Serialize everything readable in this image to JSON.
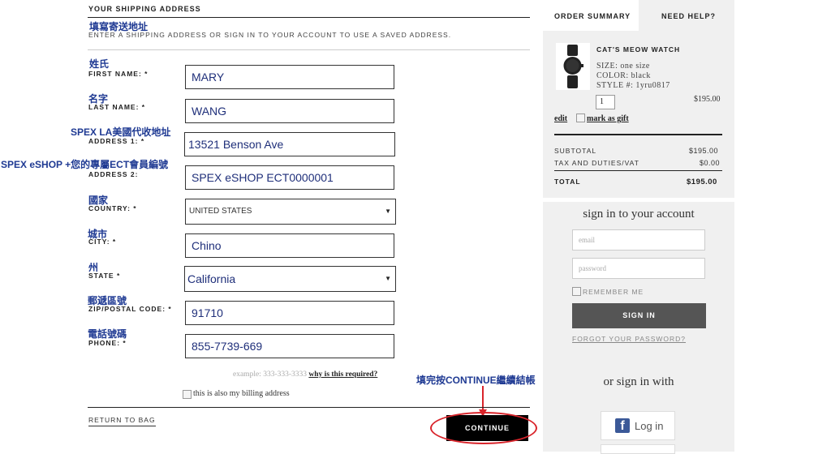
{
  "shipping": {
    "title": "YOUR SHIPPING ADDRESS",
    "title_cn": "填寫寄送地址",
    "instruction": "ENTER A SHIPPING ADDRESS OR SIGN IN TO YOUR ACCOUNT TO USE A SAVED ADDRESS.",
    "fields": {
      "first_name": {
        "label_cn": "姓氏",
        "label": "FIRST NAME: *",
        "value": "MARY"
      },
      "last_name": {
        "label_cn": "名字",
        "label": "LAST NAME: *",
        "value": "WANG"
      },
      "address1": {
        "label_cn": "SPEX LA美國代收地址",
        "label": "ADDRESS 1: *",
        "value": "13521 Benson Ave"
      },
      "address2": {
        "label_cn": "SPEX eSHOP +您的專屬ECT會員編號",
        "label": "ADDRESS 2:",
        "value": "SPEX eSHOP ECT0000001"
      },
      "country": {
        "label_cn": "國家",
        "label": "COUNTRY: *",
        "value": "UNITED STATES"
      },
      "city": {
        "label_cn": "城市",
        "label": "CITY: *",
        "value": "Chino"
      },
      "state": {
        "label_cn": "州",
        "label": "STATE *",
        "value": "California"
      },
      "zip": {
        "label_cn": "郵遞區號",
        "label": "ZIP/POSTAL CODE: *",
        "value": "91710"
      },
      "phone": {
        "label_cn": "電話號碼",
        "label": "PHONE: *",
        "value": "855-7739-669"
      }
    },
    "phone_example": "example: 333-333-3333",
    "why_required": "why is this required?",
    "billing_checkbox": "this is also my billing address",
    "return_link": "RETURN TO BAG",
    "continue_button": "CONTINUE",
    "continue_note": "填完按CONTINUE繼續結帳"
  },
  "summary": {
    "tab_summary": "ORDER SUMMARY",
    "tab_help": "NEED HELP?",
    "product": {
      "name": "CAT'S MEOW WATCH",
      "size": "SIZE: one size",
      "color": "COLOR: black",
      "style": "STYLE #: 1yru0817",
      "qty": "1",
      "price": "$195.00",
      "edit": "edit",
      "gift": "mark as gift"
    },
    "subtotal_label": "SUBTOTAL",
    "subtotal_value": "$195.00",
    "tax_label": "TAX AND DUTIES/VAT",
    "tax_value": "$0.00",
    "total_label": "TOTAL",
    "total_value": "$195.00"
  },
  "account": {
    "title": "sign in to your account",
    "email_placeholder": "email",
    "password_placeholder": "password",
    "remember": "REMEMBER ME",
    "signin_button": "SIGN IN",
    "forgot": "FORGOT YOUR PASSWORD?",
    "or_sign_in": "or sign in with",
    "facebook": "Log in"
  },
  "colors": {
    "annotation_blue": "#1f3a93",
    "highlight_red": "#d9242b",
    "facebook_blue": "#3b5998"
  }
}
